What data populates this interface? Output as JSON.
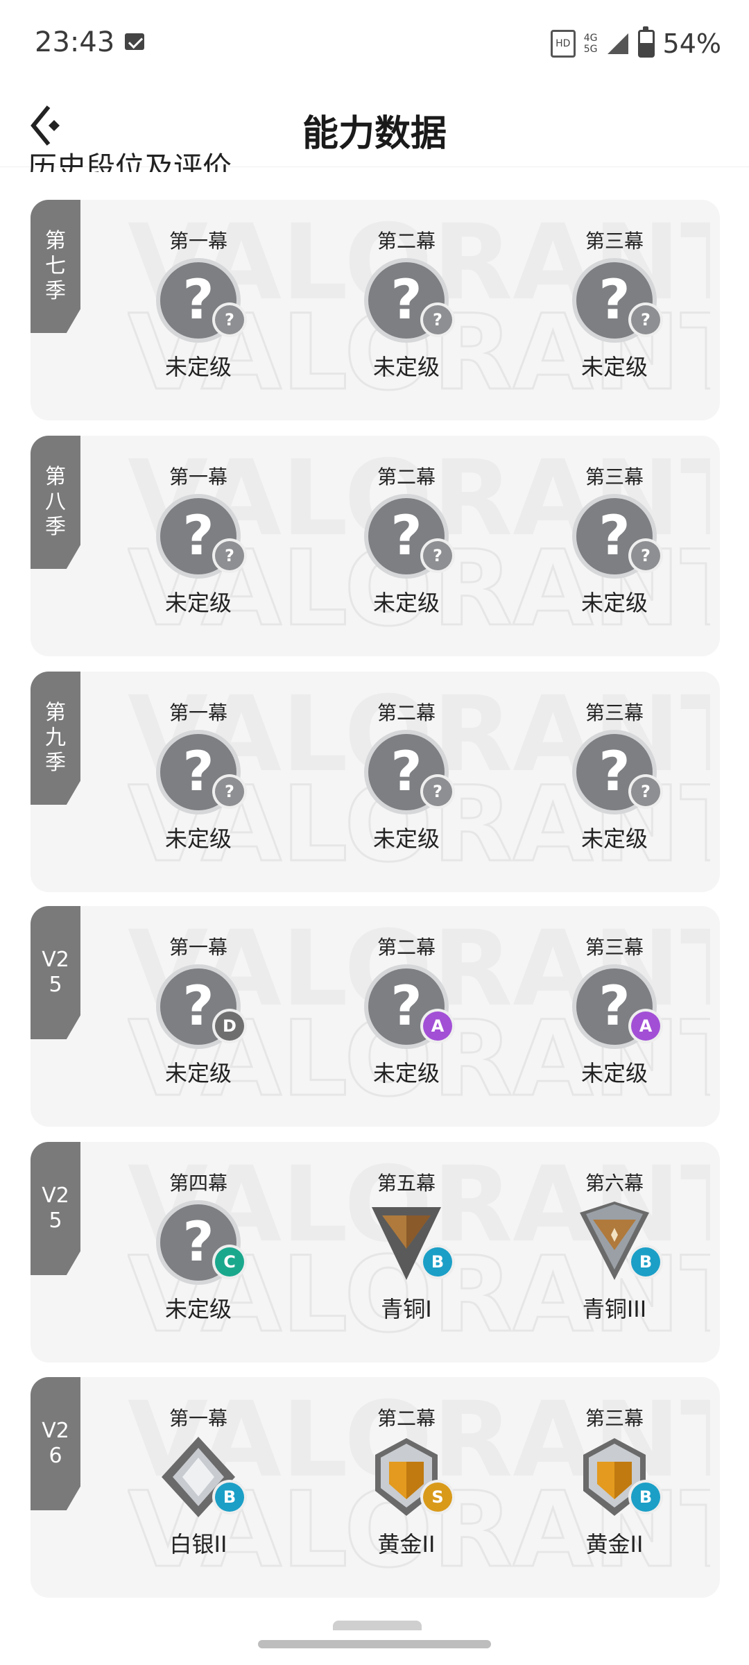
{
  "status_bar": {
    "time": "23:43",
    "network_top": "4G",
    "network_bottom": "5G",
    "battery": "54%"
  },
  "header": {
    "title": "能力数据"
  },
  "section_heading": "历史段位及评价",
  "watermark_text": "VALORANT",
  "colors": {
    "card_bg": "#f5f5f5",
    "tag_bg": "#7a7a7a",
    "unranked_gray": "#7d7f82",
    "badge_question": "#8e8f92",
    "badge_D": "#6e6e6e",
    "badge_A": "#a24fd6",
    "badge_C": "#1aa88d",
    "badge_B": "#1b9fc7",
    "badge_S": "#d99a1a"
  },
  "seasons": [
    {
      "tag": [
        "第",
        "七",
        "季"
      ],
      "acts": [
        {
          "act": "第一幕",
          "rank": "未定级",
          "emblem": "unranked-icon",
          "badge": "?",
          "badge_color": "#8e8f92"
        },
        {
          "act": "第二幕",
          "rank": "未定级",
          "emblem": "unranked-icon",
          "badge": "?",
          "badge_color": "#8e8f92"
        },
        {
          "act": "第三幕",
          "rank": "未定级",
          "emblem": "unranked-icon",
          "badge": "?",
          "badge_color": "#8e8f92"
        }
      ]
    },
    {
      "tag": [
        "第",
        "八",
        "季"
      ],
      "acts": [
        {
          "act": "第一幕",
          "rank": "未定级",
          "emblem": "unranked-icon",
          "badge": "?",
          "badge_color": "#8e8f92"
        },
        {
          "act": "第二幕",
          "rank": "未定级",
          "emblem": "unranked-icon",
          "badge": "?",
          "badge_color": "#8e8f92"
        },
        {
          "act": "第三幕",
          "rank": "未定级",
          "emblem": "unranked-icon",
          "badge": "?",
          "badge_color": "#8e8f92"
        }
      ]
    },
    {
      "tag": [
        "第",
        "九",
        "季"
      ],
      "acts": [
        {
          "act": "第一幕",
          "rank": "未定级",
          "emblem": "unranked-icon",
          "badge": "?",
          "badge_color": "#8e8f92"
        },
        {
          "act": "第二幕",
          "rank": "未定级",
          "emblem": "unranked-icon",
          "badge": "?",
          "badge_color": "#8e8f92"
        },
        {
          "act": "第三幕",
          "rank": "未定级",
          "emblem": "unranked-icon",
          "badge": "?",
          "badge_color": "#8e8f92"
        }
      ]
    },
    {
      "tag": [
        "V2",
        "5"
      ],
      "acts": [
        {
          "act": "第一幕",
          "rank": "未定级",
          "emblem": "unranked-icon",
          "badge": "D",
          "badge_color": "#6e6e6e"
        },
        {
          "act": "第二幕",
          "rank": "未定级",
          "emblem": "unranked-icon",
          "badge": "A",
          "badge_color": "#a24fd6"
        },
        {
          "act": "第三幕",
          "rank": "未定级",
          "emblem": "unranked-icon",
          "badge": "A",
          "badge_color": "#a24fd6"
        }
      ]
    },
    {
      "tag": [
        "V2",
        "5"
      ],
      "acts": [
        {
          "act": "第四幕",
          "rank": "未定级",
          "emblem": "unranked-icon",
          "badge": "C",
          "badge_color": "#1aa88d"
        },
        {
          "act": "第五幕",
          "rank": "青铜I",
          "emblem": "bronze-1-icon",
          "badge": "B",
          "badge_color": "#1b9fc7"
        },
        {
          "act": "第六幕",
          "rank": "青铜III",
          "emblem": "bronze-3-icon",
          "badge": "B",
          "badge_color": "#1b9fc7"
        }
      ]
    },
    {
      "tag": [
        "V2",
        "6"
      ],
      "acts": [
        {
          "act": "第一幕",
          "rank": "白银II",
          "emblem": "silver-2-icon",
          "badge": "B",
          "badge_color": "#1b9fc7"
        },
        {
          "act": "第二幕",
          "rank": "黄金II",
          "emblem": "gold-2-icon",
          "badge": "S",
          "badge_color": "#d99a1a"
        },
        {
          "act": "第三幕",
          "rank": "黄金II",
          "emblem": "gold-2-icon",
          "badge": "B",
          "badge_color": "#1b9fc7"
        }
      ]
    }
  ]
}
